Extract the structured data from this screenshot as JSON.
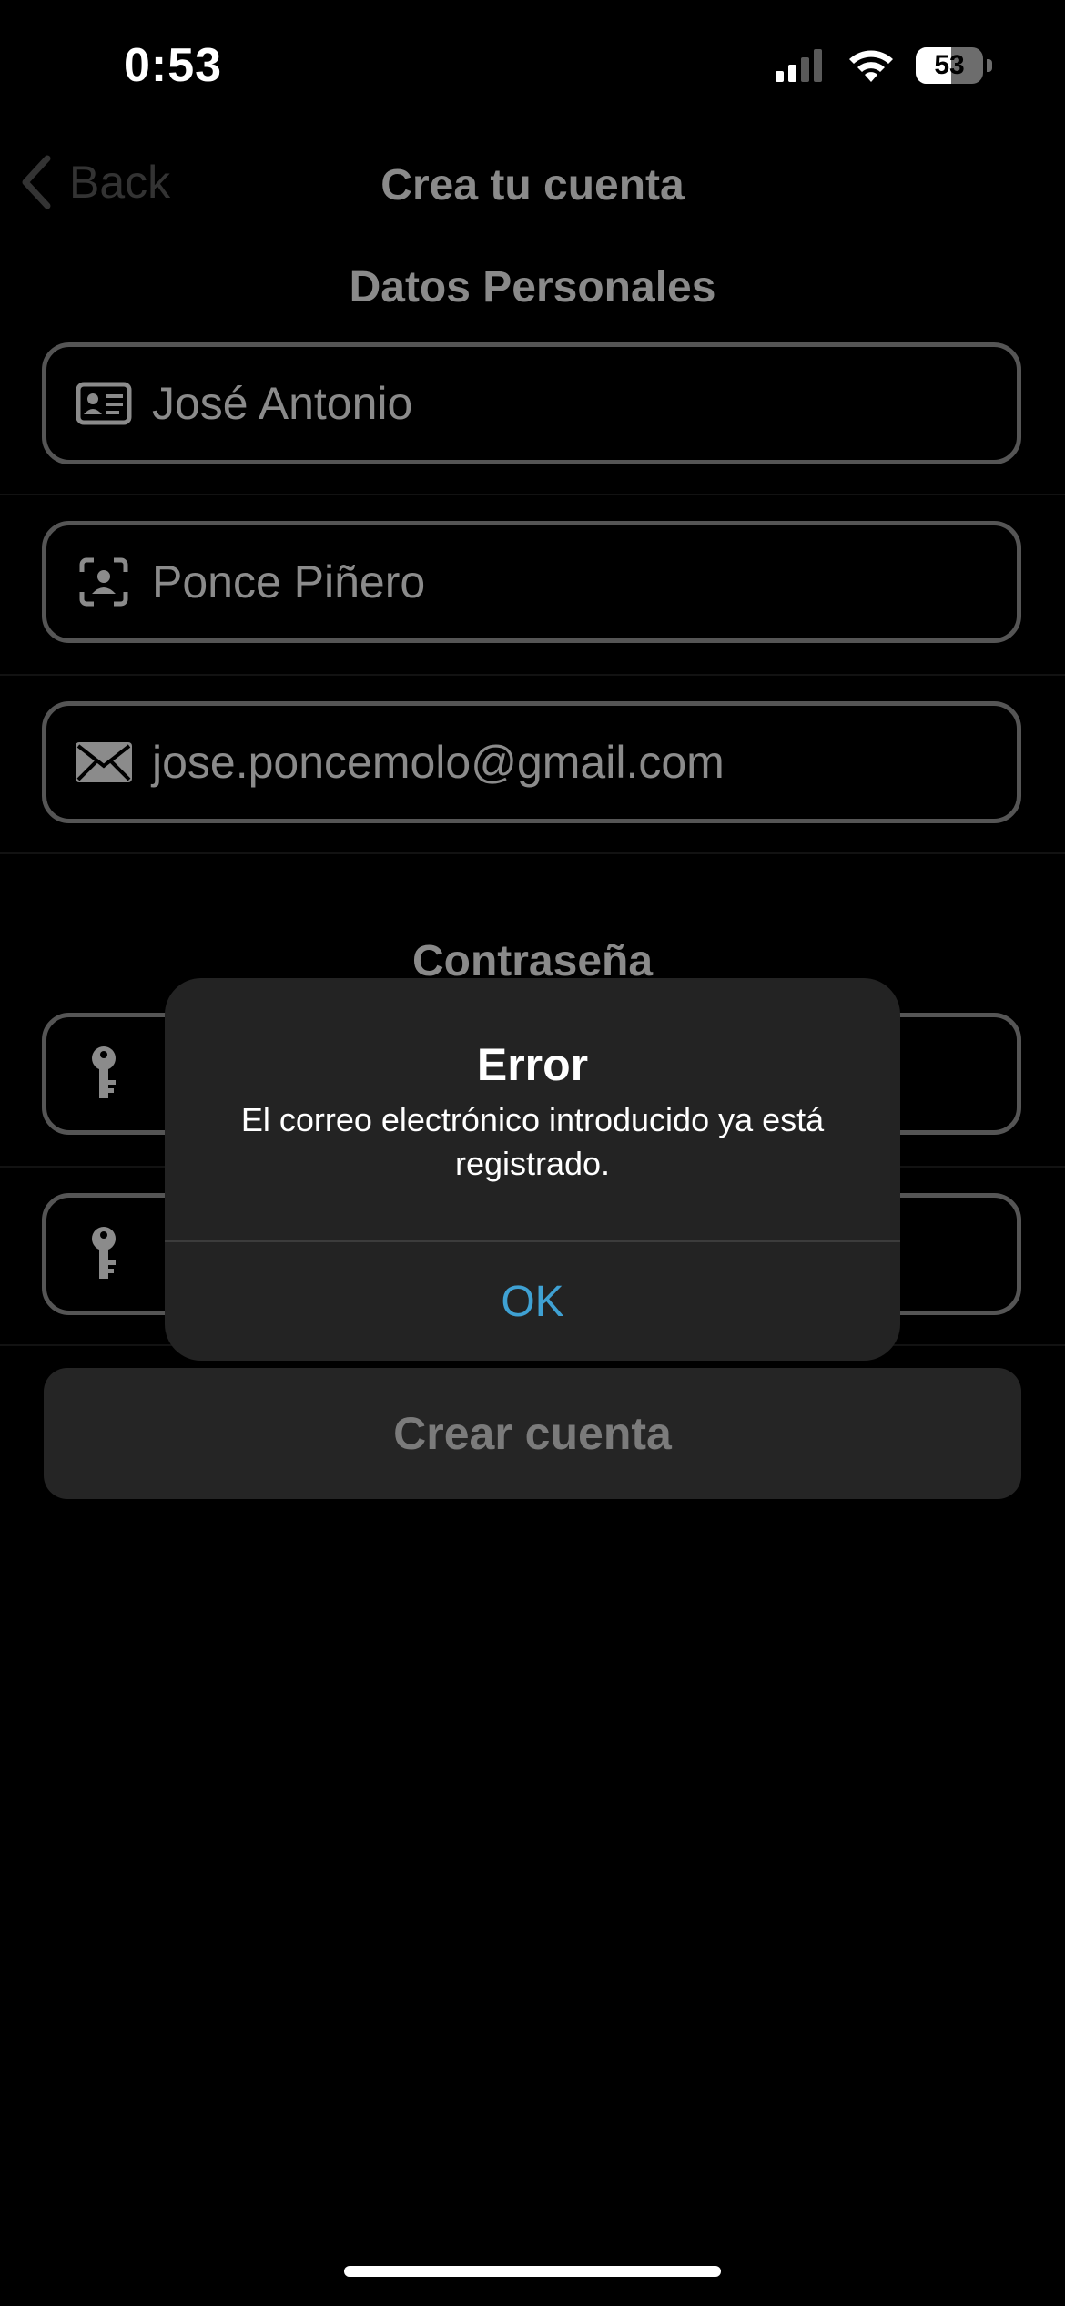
{
  "status_bar": {
    "time": "0:53",
    "battery": "53",
    "icons": [
      "cellular-signal-icon",
      "wifi-icon",
      "battery-icon"
    ]
  },
  "nav": {
    "back_label": "Back",
    "title": "Crea tu cuenta"
  },
  "personal": {
    "section_title": "Datos Personales",
    "first_name": "José Antonio",
    "last_name": "Ponce Piñero",
    "email": "jose.poncemolo@gmail.com"
  },
  "password": {
    "section_title": "Contraseña"
  },
  "create_button_label": "Crear cuenta",
  "alert": {
    "title": "Error",
    "message": "El correo electrónico introducido ya está registrado.",
    "ok_label": "OK"
  },
  "colors": {
    "background": "#000000",
    "field_border": "#555555",
    "alert_bg": "#232323",
    "alert_action": "#3fa1d3"
  }
}
